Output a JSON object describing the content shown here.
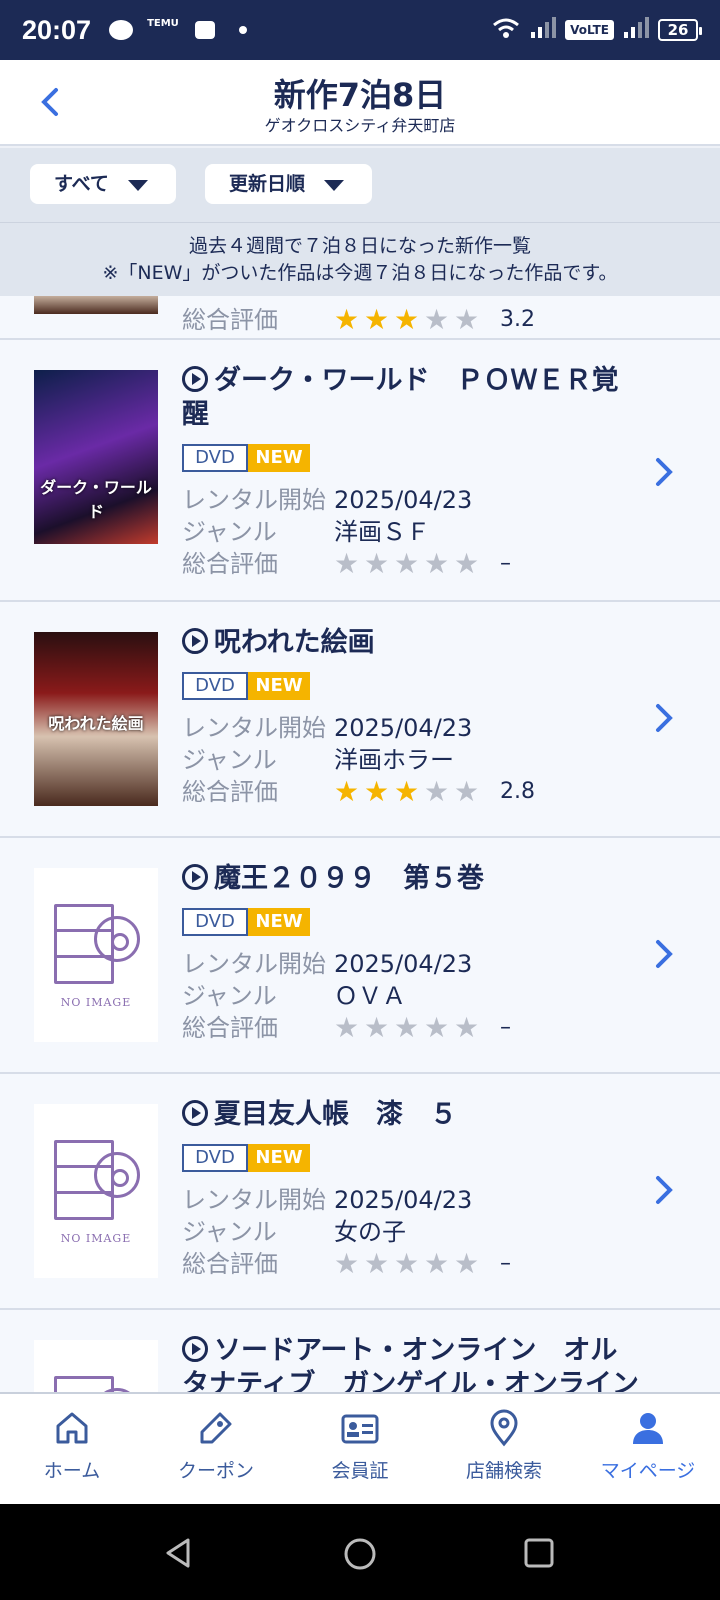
{
  "status_bar": {
    "time": "20:07",
    "temu_label": "TEMU",
    "volte": "VoLTE",
    "battery": "26"
  },
  "header": {
    "title": "新作7泊8日",
    "subtitle": "ゲオクロスシティ弁天町店"
  },
  "filters": {
    "category": "すべて",
    "sort": "更新日順"
  },
  "notice": {
    "line1": "過去４週間で７泊８日になった新作一覧",
    "line2": "※「NEW」がついた作品は今週７泊８日になった作品です。"
  },
  "labels": {
    "rental_start": "レンタル開始",
    "genre": "ジャンル",
    "rating": "総合評価",
    "dvd": "DVD",
    "new": "NEW",
    "no_image": "NO IMAGE"
  },
  "items": [
    {
      "title": "",
      "rating": 3,
      "score": "3.2"
    },
    {
      "title": "ダーク・ワールド　ＰＯＷＥＲ覚醒",
      "date": "2025/04/23",
      "genre": "洋画ＳＦ",
      "rating": 0,
      "score": "–",
      "poster_text": "ダーク・ワールド"
    },
    {
      "title": "呪われた絵画",
      "date": "2025/04/23",
      "genre": "洋画ホラー",
      "rating": 3,
      "score": "2.8",
      "poster_text": "呪われた絵画"
    },
    {
      "title": "魔王２０９９　第５巻",
      "date": "2025/04/23",
      "genre": "ＯＶＡ",
      "rating": 0,
      "score": "–"
    },
    {
      "title": "夏目友人帳　漆　５",
      "date": "2025/04/23",
      "genre": "女の子",
      "rating": 0,
      "score": "–"
    },
    {
      "title": "ソードアート・オンライン　オルタナティブ　ガンゲイル・オンライン"
    }
  ],
  "tabs": [
    {
      "label": "ホーム",
      "icon": "home-icon"
    },
    {
      "label": "クーポン",
      "icon": "coupon-icon"
    },
    {
      "label": "会員証",
      "icon": "member-card-icon"
    },
    {
      "label": "店舗検索",
      "icon": "location-pin-icon"
    },
    {
      "label": "マイページ",
      "icon": "person-icon"
    }
  ],
  "colors": {
    "navy": "#1c2a55",
    "accent": "#3a6fe0",
    "new_badge": "#f5b400"
  }
}
